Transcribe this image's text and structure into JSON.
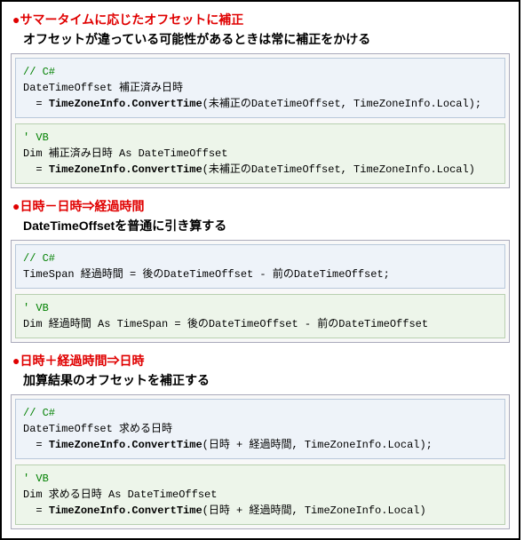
{
  "sections": [
    {
      "title_red": "サマータイムに応じたオフセットに補正",
      "title_sub": "オフセットが違っている可能性があるときは常に補正をかける",
      "cs_comment": "// C#",
      "cs_line1": "DateTimeOffset 補正済み日時",
      "cs_line2a": "  = ",
      "cs_line2b": "TimeZoneInfo.ConvertTime",
      "cs_line2c": "(未補正のDateTimeOffset, TimeZoneInfo.Local);",
      "vb_comment": "' VB",
      "vb_line1": "Dim 補正済み日時 As DateTimeOffset",
      "vb_line2a": "  = ",
      "vb_line2b": "TimeZoneInfo.ConvertTime",
      "vb_line2c": "(未補正のDateTimeOffset, TimeZoneInfo.Local)"
    },
    {
      "title_red": "日時－日時⇒経過時間",
      "title_sub": "DateTimeOffsetを普通に引き算する",
      "cs_comment": "// C#",
      "cs_line1": "TimeSpan 経過時間 = 後のDateTimeOffset - 前のDateTimeOffset;",
      "cs_line2a": "",
      "cs_line2b": "",
      "cs_line2c": "",
      "vb_comment": "' VB",
      "vb_line1": "Dim 経過時間 As TimeSpan = 後のDateTimeOffset - 前のDateTimeOffset",
      "vb_line2a": "",
      "vb_line2b": "",
      "vb_line2c": ""
    },
    {
      "title_red": "日時＋経過時間⇒日時",
      "title_sub": "加算結果のオフセットを補正する",
      "cs_comment": "// C#",
      "cs_line1": "DateTimeOffset 求める日時",
      "cs_line2a": "  = ",
      "cs_line2b": "TimeZoneInfo.ConvertTime",
      "cs_line2c": "(日時 + 経過時間, TimeZoneInfo.Local);",
      "vb_comment": "' VB",
      "vb_line1": "Dim 求める日時 As DateTimeOffset",
      "vb_line2a": "  = ",
      "vb_line2b": "TimeZoneInfo.ConvertTime",
      "vb_line2c": "(日時 + 経過時間, TimeZoneInfo.Local)"
    }
  ],
  "bullet": "●"
}
